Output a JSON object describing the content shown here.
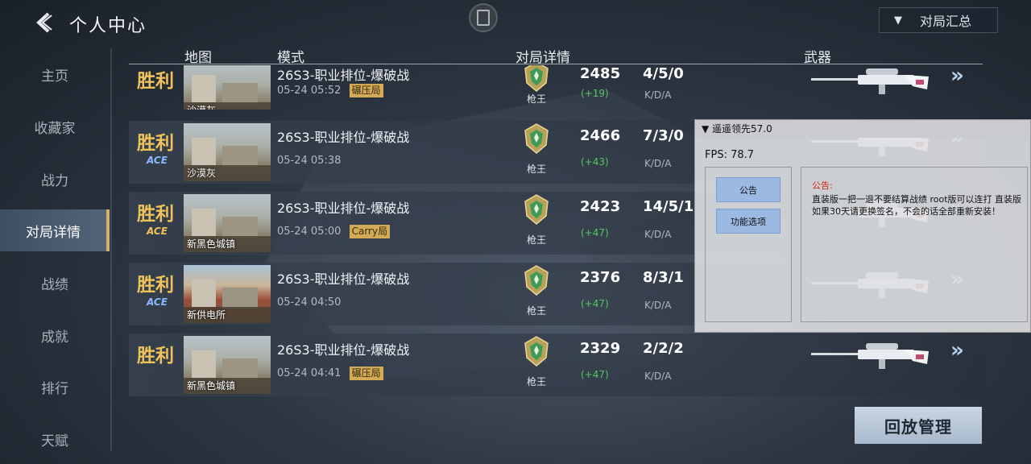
{
  "header": {
    "title": "个人中心",
    "summary_label": "对局汇总"
  },
  "sidebar": {
    "items": [
      {
        "label": "主页",
        "active": false
      },
      {
        "label": "收藏家",
        "active": false
      },
      {
        "label": "战力",
        "active": false
      },
      {
        "label": "对局详情",
        "active": true
      },
      {
        "label": "战绩",
        "active": false
      },
      {
        "label": "成就",
        "active": false
      },
      {
        "label": "排行",
        "active": false
      },
      {
        "label": "天赋",
        "active": false
      }
    ]
  },
  "columns": {
    "map": "地图",
    "mode": "模式",
    "details": "对局详情",
    "weapon": "武器"
  },
  "matches": [
    {
      "result": "胜利",
      "ace": "",
      "map": "沙漠灰",
      "mode": "26S3-职业排位-爆破战",
      "time": "05-24 05:52",
      "tag": "碾压局",
      "rank": "枪王",
      "score": "2485",
      "delta": "(+19)",
      "kda": "4/5/0",
      "kda_label": "K/D/A"
    },
    {
      "result": "胜利",
      "ace": "ACE",
      "map": "沙漠灰",
      "mode": "26S3-职业排位-爆破战",
      "time": "05-24 05:38",
      "tag": "",
      "rank": "枪王",
      "score": "2466",
      "delta": "(+43)",
      "kda": "7/3/0",
      "kda_label": "K/D/A"
    },
    {
      "result": "胜利",
      "ace": "ACE",
      "map": "新黑色城镇",
      "mode": "26S3-职业排位-爆破战",
      "time": "05-24 05:00",
      "tag": "Carry局",
      "rank": "枪王",
      "score": "2423",
      "delta": "(+47)",
      "kda": "14/5/1",
      "kda_label": "K/D/A"
    },
    {
      "result": "胜利",
      "ace": "ACE",
      "map": "新供电所",
      "mode": "26S3-职业排位-爆破战",
      "time": "05-24 04:50",
      "tag": "",
      "rank": "枪王",
      "score": "2376",
      "delta": "(+47)",
      "kda": "8/3/1",
      "kda_label": "K/D/A"
    },
    {
      "result": "胜利",
      "ace": "",
      "map": "新黑色城镇",
      "mode": "26S3-职业排位-爆破战",
      "time": "05-24 04:41",
      "tag": "碾压局",
      "rank": "枪王",
      "score": "2329",
      "delta": "(+47)",
      "kda": "2/2/2",
      "kda_label": "K/D/A"
    }
  ],
  "overlay": {
    "title": "▼ 遥遥领先57.0",
    "fps": "FPS: 78.7",
    "btn_notice": "公告",
    "btn_features": "功能选项",
    "notice_title": "公告:",
    "notice_body": "直装版一把一退不要结算战绩 root版可以连打 直装版如果30天请更换签名，不会的话全部重新安装！"
  },
  "replay_label": "回放管理",
  "colors": {
    "accent_gold": "#f0c35a",
    "active_bar": "#d6b06a",
    "delta_green": "#59c266",
    "overlay_btn": "#9bb9e2"
  }
}
